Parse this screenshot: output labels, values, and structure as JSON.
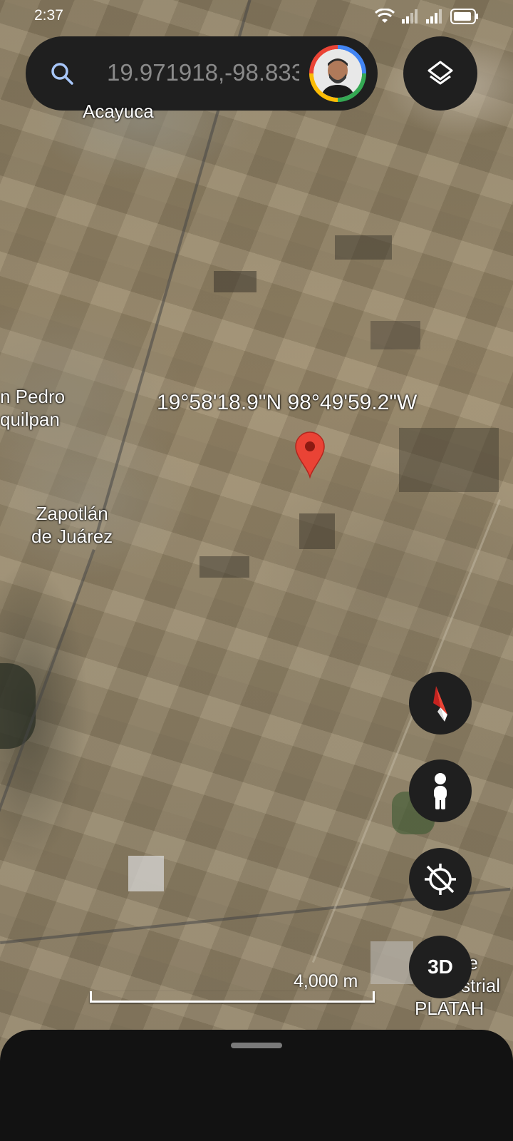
{
  "status_bar": {
    "time": "2:37"
  },
  "search": {
    "value": "19.971918,-98.833"
  },
  "map": {
    "labels": {
      "acayuca": "Acayuca",
      "san_pedro_line1": "n Pedro",
      "san_pedro_line2": "quilpan",
      "zapotlan_line1": "Zapotlán",
      "zapotlan_line2": "de Juárez",
      "industrial_line1": "ue",
      "industrial_line2": "Industrial",
      "industrial_line3": "PLATAH"
    },
    "coordinates": "19°58'18.9\"N 98°49'59.2\"W",
    "scale": "4,000 m"
  },
  "controls": {
    "three_d_label": "3D"
  },
  "icons": {
    "search": "search-icon",
    "layers": "layers-icon",
    "compass": "compass-icon",
    "street_view": "pegman-icon",
    "location": "location-off-icon"
  },
  "colors": {
    "pin": "#ea4335",
    "panel": "#1f1f1f"
  }
}
